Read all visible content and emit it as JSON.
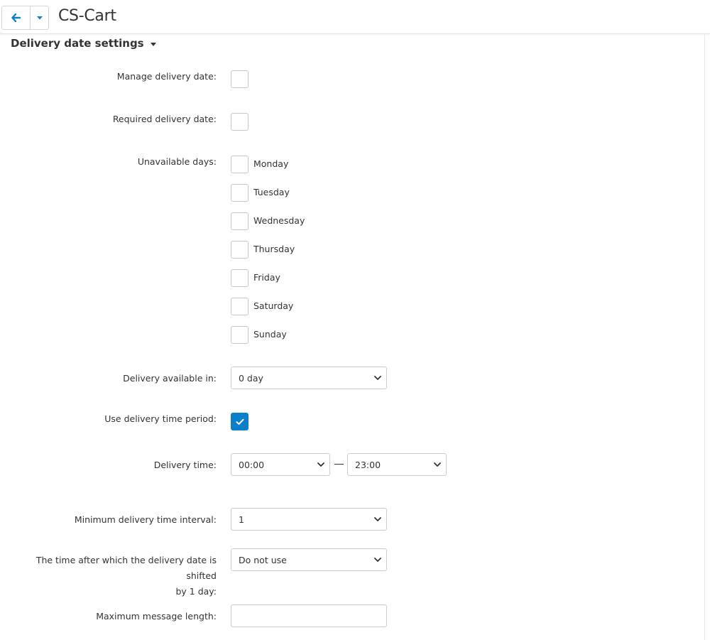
{
  "header": {
    "title": "CS-Cart",
    "accent_color": "#0388cc",
    "back_icon": "arrow-left-icon",
    "dropdown_icon": "caret-down-icon"
  },
  "section": {
    "title": "Delivery date settings"
  },
  "fields": {
    "manage_delivery_date": {
      "label": "Manage delivery date:",
      "checked": false
    },
    "required_delivery_date": {
      "label": "Required delivery date:",
      "checked": false
    },
    "unavailable_days": {
      "label": "Unavailable days:",
      "days": [
        {
          "name": "Monday",
          "checked": false
        },
        {
          "name": "Tuesday",
          "checked": false
        },
        {
          "name": "Wednesday",
          "checked": false
        },
        {
          "name": "Thursday",
          "checked": false
        },
        {
          "name": "Friday",
          "checked": false
        },
        {
          "name": "Saturday",
          "checked": false
        },
        {
          "name": "Sunday",
          "checked": false
        }
      ]
    },
    "delivery_available_in": {
      "label": "Delivery available in:",
      "value": "0 day"
    },
    "use_delivery_time_period": {
      "label": "Use delivery time period:",
      "checked": true,
      "color": "#0b7fc9"
    },
    "delivery_time": {
      "label": "Delivery time:",
      "from": "00:00",
      "to": "23:00"
    },
    "min_interval": {
      "label": "Minimum delivery time interval:",
      "value": "1"
    },
    "shift_time": {
      "label_line1": "The time after which the delivery date is shifted",
      "label_line2": "by 1 day:",
      "value": "Do not use"
    },
    "max_message_length": {
      "label": "Maximum message length:",
      "value": ""
    }
  }
}
